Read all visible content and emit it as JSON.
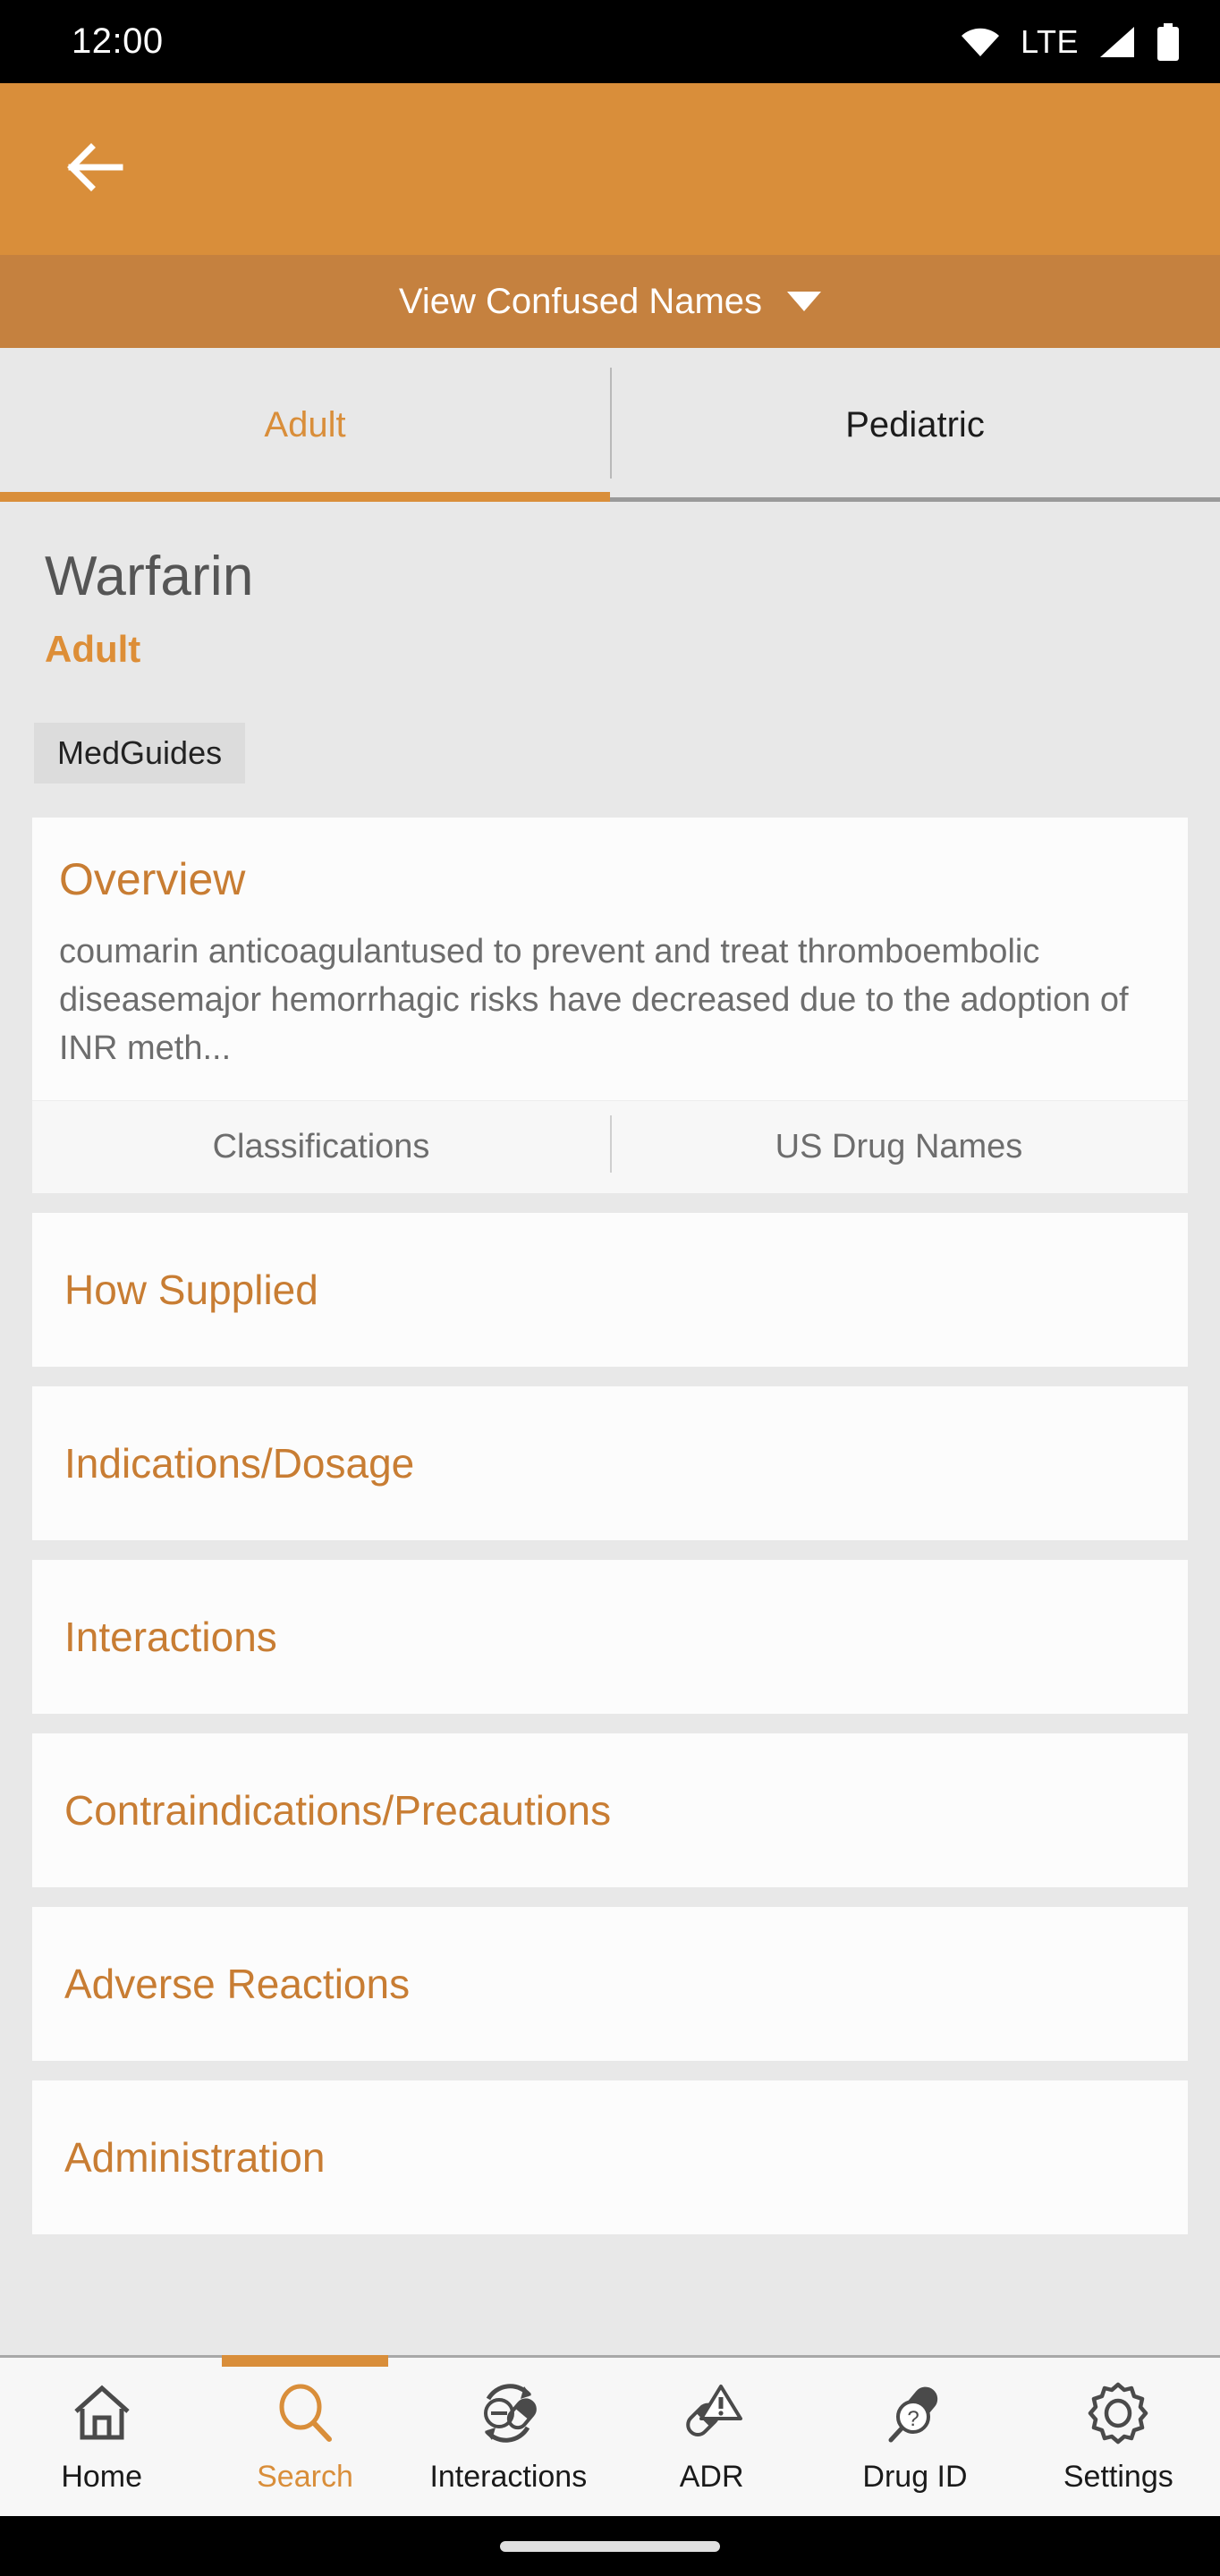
{
  "status_bar": {
    "clock": "12:00",
    "network_label": "LTE",
    "icons": [
      "wifi-icon",
      "signal-icon",
      "battery-icon"
    ]
  },
  "app_bar": {
    "back_icon": "back-arrow-icon",
    "background_color": "#d98e3a"
  },
  "confused_names_bar": {
    "label": "View Confused Names",
    "caret_icon": "chevron-down-icon",
    "background_color": "#c5813f"
  },
  "tabs": [
    {
      "label": "Adult",
      "active": true
    },
    {
      "label": "Pediatric",
      "active": false
    }
  ],
  "drug": {
    "name": "Warfarin",
    "population": "Adult",
    "chips": [
      "MedGuides"
    ]
  },
  "overview": {
    "title": "Overview",
    "body": "coumarin anticoagulantused to prevent and treat thromboembolic diseasemajor hemorrhagic risks have decreased due to the adoption of INR meth...",
    "sub_actions": [
      "Classifications",
      "US Drug Names"
    ]
  },
  "sections": [
    {
      "label": "How Supplied"
    },
    {
      "label": "Indications/Dosage"
    },
    {
      "label": "Interactions"
    },
    {
      "label": "Contraindications/Precautions"
    },
    {
      "label": "Adverse Reactions"
    },
    {
      "label": "Administration"
    }
  ],
  "bottom_nav": [
    {
      "label": "Home",
      "icon": "home-icon",
      "active": false
    },
    {
      "label": "Search",
      "icon": "search-icon",
      "active": true
    },
    {
      "label": "Interactions",
      "icon": "interactions-icon",
      "active": false
    },
    {
      "label": "ADR",
      "icon": "adr-warning-icon",
      "active": false
    },
    {
      "label": "Drug ID",
      "icon": "drug-id-icon",
      "active": false
    },
    {
      "label": "Settings",
      "icon": "gear-icon",
      "active": false
    }
  ],
  "theme": {
    "accent": "#d98e3a",
    "accent_dark": "#c5813f",
    "card_title": "#c87d33",
    "page_background": "#e8e8e8",
    "card_background": "#fcfcfc"
  }
}
